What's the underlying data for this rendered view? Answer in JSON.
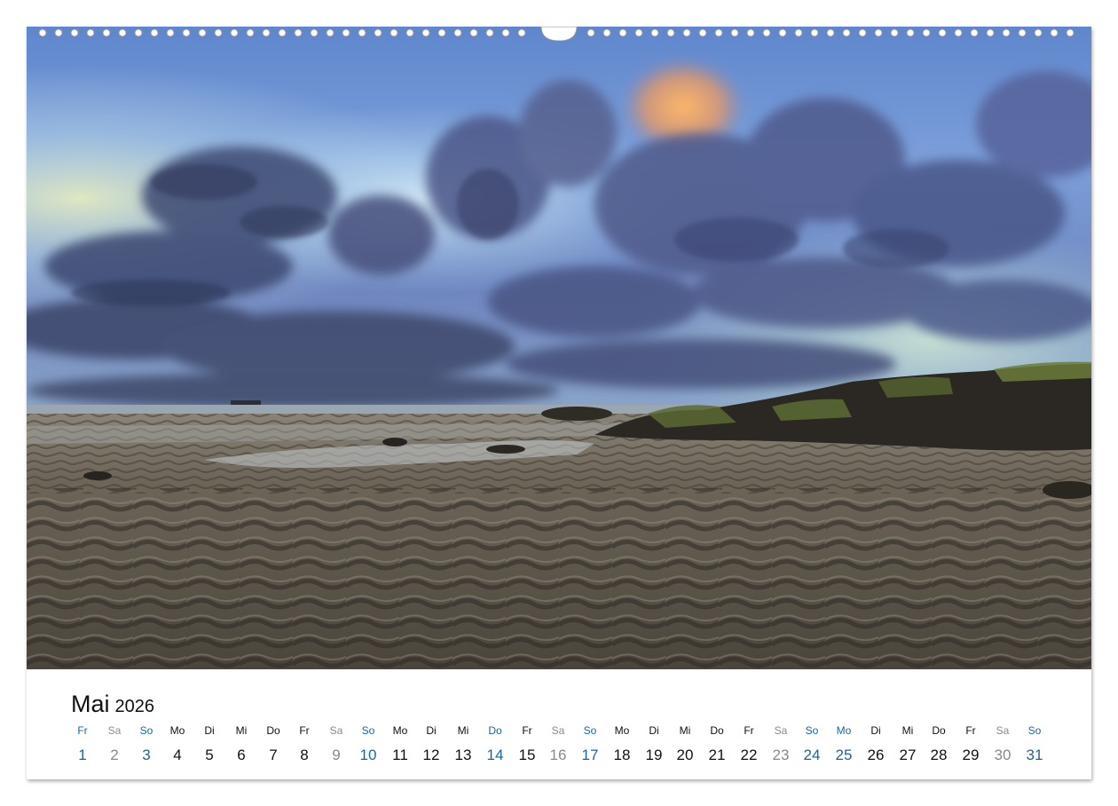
{
  "calendar": {
    "month": "Mai",
    "year": "2026",
    "colors": {
      "weekday": "#111111",
      "saturday": "#8a8a8a",
      "sunday_holiday": "#1a6796"
    },
    "days": [
      {
        "dn": "Fr",
        "dd": "1",
        "kind": "sun"
      },
      {
        "dn": "Sa",
        "dd": "2",
        "kind": "sat"
      },
      {
        "dn": "So",
        "dd": "3",
        "kind": "sun"
      },
      {
        "dn": "Mo",
        "dd": "4",
        "kind": "weekday"
      },
      {
        "dn": "Di",
        "dd": "5",
        "kind": "weekday"
      },
      {
        "dn": "Mi",
        "dd": "6",
        "kind": "weekday"
      },
      {
        "dn": "Do",
        "dd": "7",
        "kind": "weekday"
      },
      {
        "dn": "Fr",
        "dd": "8",
        "kind": "weekday"
      },
      {
        "dn": "Sa",
        "dd": "9",
        "kind": "sat"
      },
      {
        "dn": "So",
        "dd": "10",
        "kind": "sun"
      },
      {
        "dn": "Mo",
        "dd": "11",
        "kind": "weekday"
      },
      {
        "dn": "Di",
        "dd": "12",
        "kind": "weekday"
      },
      {
        "dn": "Mi",
        "dd": "13",
        "kind": "weekday"
      },
      {
        "dn": "Do",
        "dd": "14",
        "kind": "sun"
      },
      {
        "dn": "Fr",
        "dd": "15",
        "kind": "weekday"
      },
      {
        "dn": "Sa",
        "dd": "16",
        "kind": "sat"
      },
      {
        "dn": "So",
        "dd": "17",
        "kind": "sun"
      },
      {
        "dn": "Mo",
        "dd": "18",
        "kind": "weekday"
      },
      {
        "dn": "Di",
        "dd": "19",
        "kind": "weekday"
      },
      {
        "dn": "Mi",
        "dd": "20",
        "kind": "weekday"
      },
      {
        "dn": "Do",
        "dd": "21",
        "kind": "weekday"
      },
      {
        "dn": "Fr",
        "dd": "22",
        "kind": "weekday"
      },
      {
        "dn": "Sa",
        "dd": "23",
        "kind": "sat"
      },
      {
        "dn": "So",
        "dd": "24",
        "kind": "sun"
      },
      {
        "dn": "Mo",
        "dd": "25",
        "kind": "sun"
      },
      {
        "dn": "Di",
        "dd": "26",
        "kind": "weekday"
      },
      {
        "dn": "Mi",
        "dd": "27",
        "kind": "weekday"
      },
      {
        "dn": "Do",
        "dd": "28",
        "kind": "weekday"
      },
      {
        "dn": "Fr",
        "dd": "29",
        "kind": "weekday"
      },
      {
        "dn": "Sa",
        "dd": "30",
        "kind": "sat"
      },
      {
        "dn": "So",
        "dd": "31",
        "kind": "sun"
      }
    ]
  }
}
